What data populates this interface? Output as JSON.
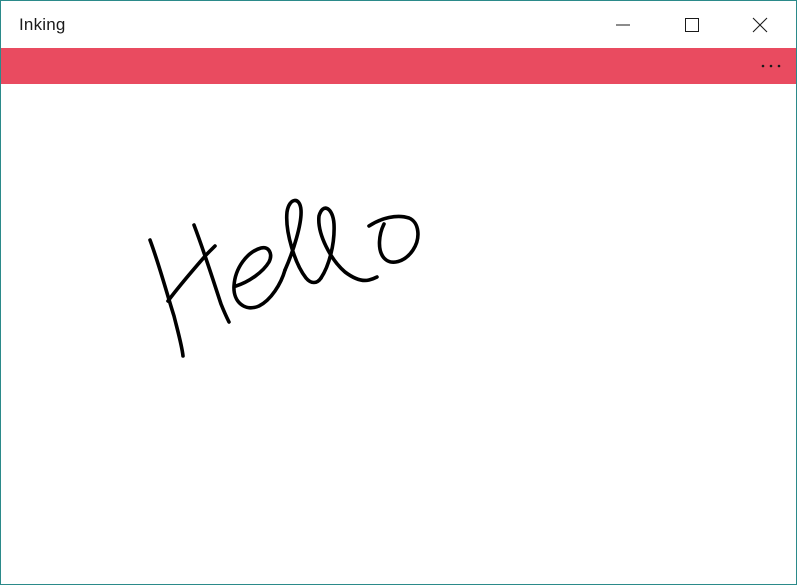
{
  "window": {
    "title": "Inking"
  },
  "colors": {
    "accent": "#e94b60",
    "ink": "#000000",
    "border": "#2b8a8a"
  },
  "icons": {
    "minimize": "minimize-icon",
    "maximize": "maximize-icon",
    "close": "close-icon",
    "more": "more-icon"
  }
}
